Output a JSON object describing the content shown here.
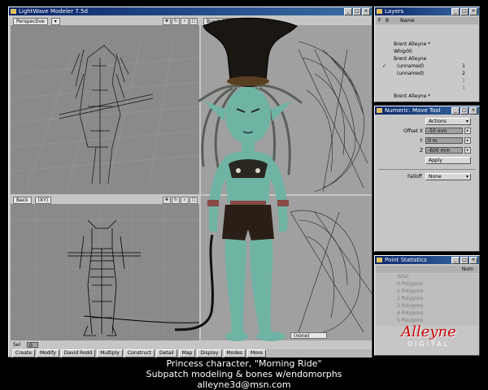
{
  "modeler": {
    "title": "LightWave Modeler 7.5d",
    "viewports": {
      "top_left": {
        "view": "Perspective"
      },
      "top_right": {
        "name": "Brent Alleyne *"
      },
      "bottom_left": {
        "view": "Back",
        "axis": "(XY)"
      },
      "bottom_right": {
        "value": "(none)"
      }
    },
    "sel_label": "Sel",
    "sel_value": "0",
    "toolbar": [
      "Create",
      "Modify",
      "David Rodd",
      "Multiply",
      "Construct",
      "Detail",
      "Map",
      "Display",
      "Modes",
      "More"
    ]
  },
  "layers": {
    "title": "Layers",
    "cols": {
      "f": "F",
      "b": "B",
      "name": "Name"
    },
    "items": [
      {
        "name": "Brent Alleyne *",
        "num": ""
      },
      {
        "name": "Whip00",
        "num": ""
      },
      {
        "name": "Brent Alleyne",
        "num": ""
      },
      {
        "name": "(unnamed)",
        "num": "1"
      },
      {
        "name": "(unnamed)",
        "num": "2"
      },
      {
        "name": "",
        "num": "1"
      },
      {
        "name": "",
        "num": "1"
      },
      {
        "name": "Brent Alleyne *",
        "num": ""
      }
    ]
  },
  "numeric": {
    "title": "Numeric: Move Tool",
    "actions": "Actions",
    "offset_x_label": "Offset X",
    "offset_x": "-50 mm",
    "y_label": "Y",
    "y": "0 m",
    "z_label": "Z",
    "z": "-600 mm",
    "apply": "Apply",
    "falloff_label": "Falloff",
    "falloff": "None"
  },
  "stats": {
    "title": "Point Statistics",
    "num_col": "Num",
    "rows": [
      "Total",
      "0 Polygons",
      "1 Polygons",
      "2 Polygons",
      "3 Polygons",
      "4 Polygons",
      "5 Polygons"
    ]
  },
  "logo": {
    "brand": "Alleyne",
    "sub": "DIGITAL"
  },
  "caption": {
    "line1": "Princess character, \"Morning Ride\"",
    "line2": "Subpatch modeling & bones w/endomorphs",
    "line3": "alleyne3d@msn.com"
  },
  "colors": {
    "skin": "#6fb3a3",
    "title_bar": "#0a246a",
    "viewport": "#8a8a8a",
    "panel": "#c6c6c6"
  },
  "icons": {
    "window_minimize": "minimize-icon",
    "window_maximize": "maximize-icon",
    "window_close": "close-icon",
    "app": "lightwave-icon"
  }
}
